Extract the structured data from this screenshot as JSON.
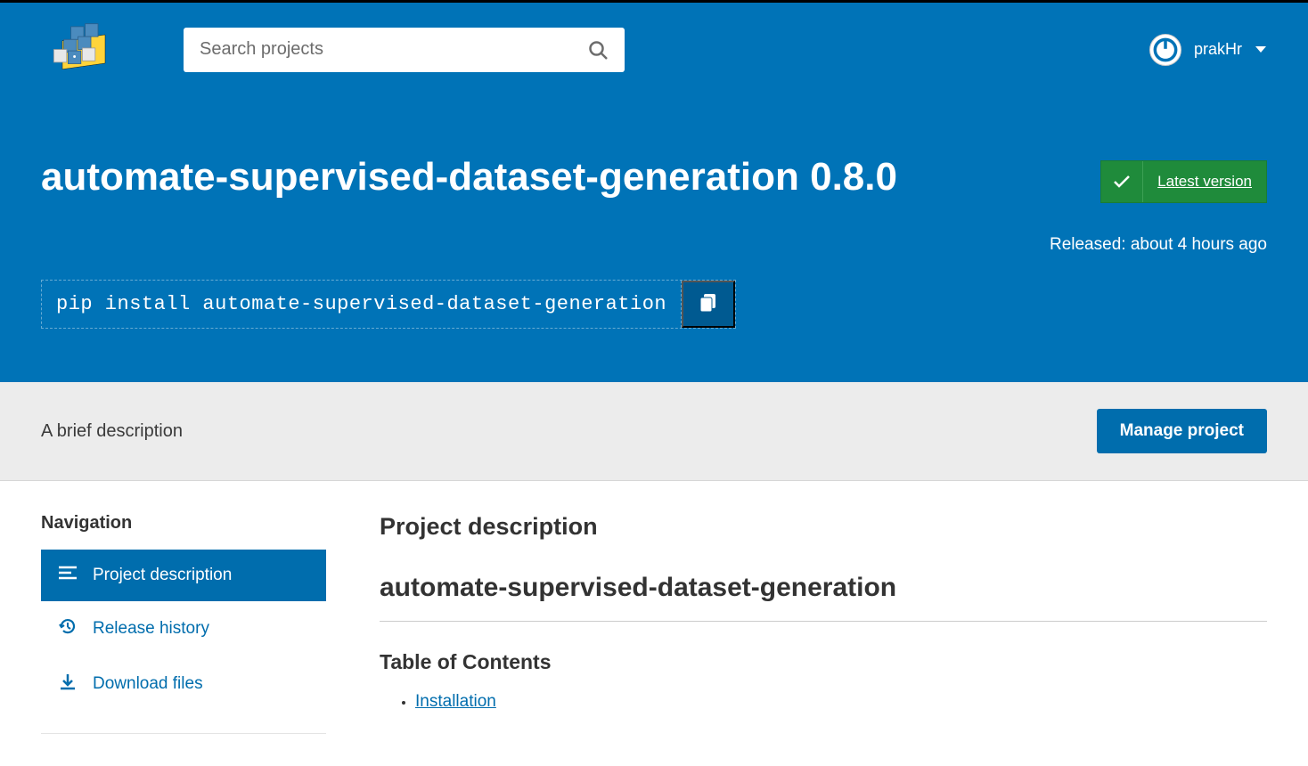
{
  "search": {
    "placeholder": "Search projects"
  },
  "user": {
    "name": "prakHr"
  },
  "package": {
    "title": "automate-supervised-dataset-generation 0.8.0",
    "latest_label": "Latest version",
    "released": "Released: about 4 hours ago",
    "pip_command": "pip install automate-supervised-dataset-generation",
    "summary": "A brief description",
    "manage_label": "Manage project"
  },
  "sidebar": {
    "heading": "Navigation",
    "items": [
      {
        "label": "Project description"
      },
      {
        "label": "Release history"
      },
      {
        "label": "Download files"
      }
    ]
  },
  "main": {
    "section_heading": "Project description",
    "package_heading": "automate-supervised-dataset-generation",
    "toc_heading": "Table of Contents",
    "toc": [
      {
        "label": "Installation"
      }
    ]
  }
}
